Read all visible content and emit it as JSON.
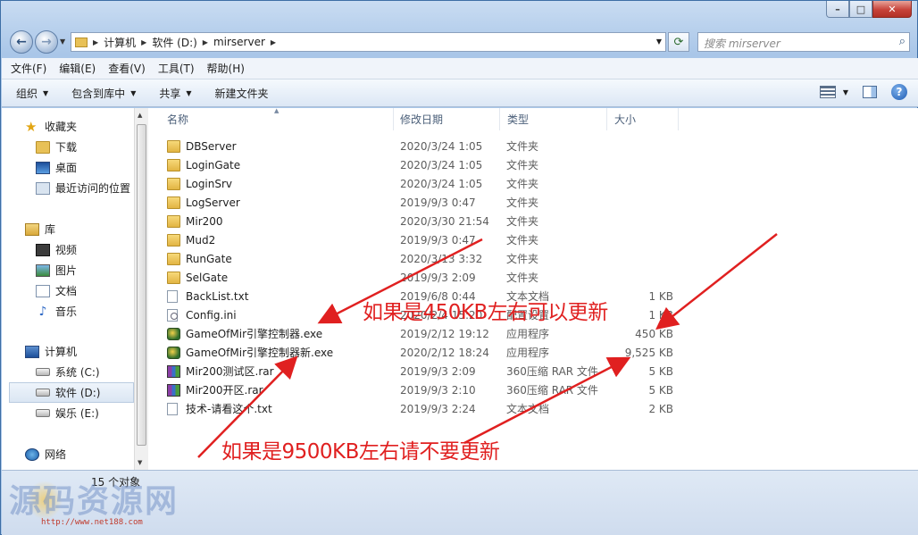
{
  "window": {
    "controls": {
      "minimize": "–",
      "maximize": "□",
      "close": "✕"
    }
  },
  "nav": {
    "back_icon": "back-arrow-icon",
    "forward_icon": "forward-arrow-icon",
    "breadcrumbs": [
      "计算机",
      "软件 (D:)",
      "mirserver"
    ],
    "search_placeholder": "搜索 mirserver"
  },
  "menubar": [
    "文件(F)",
    "编辑(E)",
    "查看(V)",
    "工具(T)",
    "帮助(H)"
  ],
  "commandbar": {
    "organize": "组织",
    "include_library": "包含到库中",
    "share": "共享",
    "new_folder": "新建文件夹"
  },
  "sidebar": {
    "favorites": {
      "label": "收藏夹",
      "items": [
        "下载",
        "桌面",
        "最近访问的位置"
      ]
    },
    "libraries": {
      "label": "库",
      "items": [
        "视频",
        "图片",
        "文档",
        "音乐"
      ]
    },
    "computer": {
      "label": "计算机",
      "items": [
        "系统 (C:)",
        "软件 (D:)",
        "娱乐 (E:)"
      ]
    },
    "network": {
      "label": "网络"
    }
  },
  "columns": {
    "name": "名称",
    "date": "修改日期",
    "type": "类型",
    "size": "大小"
  },
  "files": [
    {
      "name": "DBServer",
      "date": "2020/3/24 1:05",
      "type": "文件夹",
      "size": "",
      "icon": "folder"
    },
    {
      "name": "LoginGate",
      "date": "2020/3/24 1:05",
      "type": "文件夹",
      "size": "",
      "icon": "folder"
    },
    {
      "name": "LoginSrv",
      "date": "2020/3/24 1:05",
      "type": "文件夹",
      "size": "",
      "icon": "folder"
    },
    {
      "name": "LogServer",
      "date": "2019/9/3 0:47",
      "type": "文件夹",
      "size": "",
      "icon": "folder"
    },
    {
      "name": "Mir200",
      "date": "2020/3/30 21:54",
      "type": "文件夹",
      "size": "",
      "icon": "folder"
    },
    {
      "name": "Mud2",
      "date": "2019/9/3 0:47",
      "type": "文件夹",
      "size": "",
      "icon": "folder"
    },
    {
      "name": "RunGate",
      "date": "2020/3/13 3:32",
      "type": "文件夹",
      "size": "",
      "icon": "folder"
    },
    {
      "name": "SelGate",
      "date": "2019/9/3 2:09",
      "type": "文件夹",
      "size": "",
      "icon": "folder"
    },
    {
      "name": "BackList.txt",
      "date": "2019/6/8 0:44",
      "type": "文本文档",
      "size": "1 KB",
      "icon": "txt"
    },
    {
      "name": "Config.ini",
      "date": "2020/2/4 15:20",
      "type": "配置设置",
      "size": "1 KB",
      "icon": "ini"
    },
    {
      "name": "GameOfMir引擎控制器.exe",
      "date": "2019/2/12 19:12",
      "type": "应用程序",
      "size": "450 KB",
      "icon": "exe"
    },
    {
      "name": "GameOfMir引擎控制器新.exe",
      "date": "2020/2/12 18:24",
      "type": "应用程序",
      "size": "9,525 KB",
      "icon": "exe"
    },
    {
      "name": "Mir200测试区.rar",
      "date": "2019/9/3 2:09",
      "type": "360压缩 RAR 文件",
      "size": "5 KB",
      "icon": "rar"
    },
    {
      "name": "Mir200开区.rar",
      "date": "2019/9/3 2:10",
      "type": "360压缩 RAR 文件",
      "size": "5 KB",
      "icon": "rar"
    },
    {
      "name": "技术-请看这个.txt",
      "date": "2019/9/3 2:24",
      "type": "文本文档",
      "size": "2 KB",
      "icon": "txt"
    }
  ],
  "status": {
    "count": "15 个对象"
  },
  "annotations": {
    "note1": "如果是450KB左右可以更新",
    "note2": "如果是9500KB左右请不要更新",
    "color": "#e02020"
  },
  "watermark": {
    "text": "源码资源网",
    "url": "http://www.net188.com"
  }
}
